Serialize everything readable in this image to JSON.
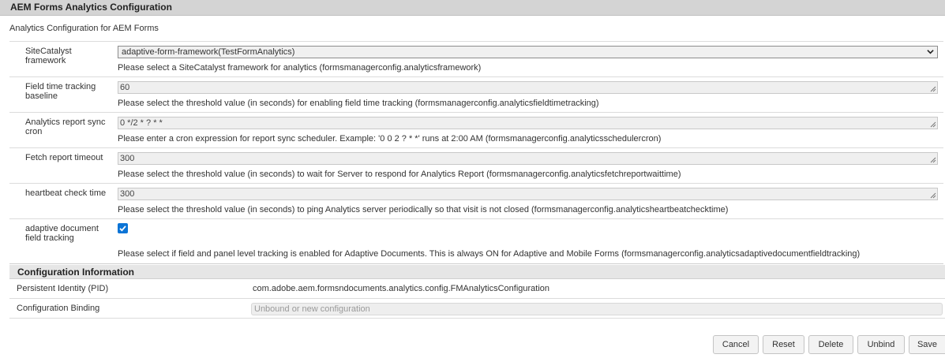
{
  "dialog": {
    "title": "AEM Forms Analytics Configuration",
    "subtitle": "Analytics Configuration for AEM Forms"
  },
  "fields": [
    {
      "label": "SiteCatalyst framework",
      "value": "adaptive-form-framework(TestFormAnalytics)",
      "description": "Please select a SiteCatalyst framework for analytics (formsmanagerconfig.analyticsframework)"
    },
    {
      "label": "Field time tracking baseline",
      "value": "60",
      "description": "Please select the threshold value (in seconds) for enabling field time tracking (formsmanagerconfig.analyticsfieldtimetracking)"
    },
    {
      "label": "Analytics report sync cron",
      "value": "0 */2 * ? * *",
      "description": "Please enter a cron expression for report sync scheduler. Example: '0 0 2 ? * *' runs at 2:00 AM (formsmanagerconfig.analyticsschedulercron)"
    },
    {
      "label": "Fetch report timeout",
      "value": "300",
      "description": "Please select the threshold value (in seconds) to wait for Server to respond for Analytics Report (formsmanagerconfig.analyticsfetchreportwaittime)"
    },
    {
      "label": "heartbeat check time",
      "value": "300",
      "description": "Please select the threshold value (in seconds) to ping Analytics server periodically so that visit is not closed (formsmanagerconfig.analyticsheartbeatchecktime)"
    },
    {
      "label": "adaptive document field tracking",
      "checked": true,
      "description": "Please select if field and panel level tracking is enabled for Adaptive Documents. This is always ON for Adaptive and Mobile Forms (formsmanagerconfig.analyticsadaptivedocumentfieldtracking)"
    }
  ],
  "config_info": {
    "header": "Configuration Information",
    "pid_label": "Persistent Identity (PID)",
    "pid_value": "com.adobe.aem.formsndocuments.analytics.config.FMAnalyticsConfiguration",
    "binding_label": "Configuration Binding",
    "binding_placeholder": "Unbound or new configuration"
  },
  "buttons": {
    "cancel": "Cancel",
    "reset": "Reset",
    "delete": "Delete",
    "unbind": "Unbind",
    "save": "Save"
  },
  "colors": {
    "title_bar": "#d4d4d4",
    "section_header": "#e6e6e6",
    "checkbox_accent": "#0b74d6"
  },
  "icons": {
    "select": "chevron-down-icon",
    "textarea": "resize-grip-icon",
    "checkbox": "checkmark-icon"
  }
}
